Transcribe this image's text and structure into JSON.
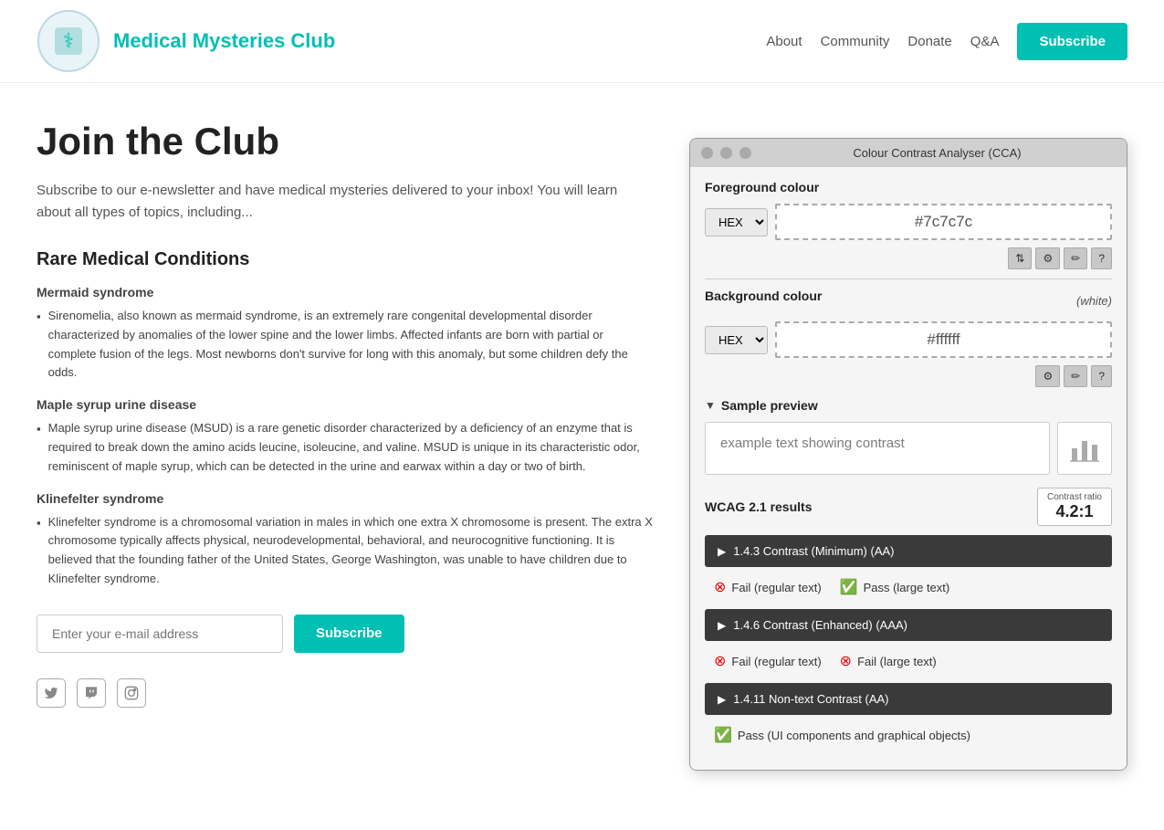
{
  "header": {
    "site_title": "Medical Mysteries Club",
    "nav": {
      "about": "About",
      "community": "Community",
      "donate": "Donate",
      "qa": "Q&A",
      "subscribe": "Subscribe"
    }
  },
  "main": {
    "page_title": "Join the Club",
    "intro": "Subscribe to our e-newsletter and have medical mysteries delivered to your inbox! You will learn about all types of topics, including...",
    "section_title": "Rare Medical Conditions",
    "conditions": [
      {
        "name": "Mermaid syndrome",
        "description": "Sirenomelia, also known as mermaid syndrome, is an extremely rare congenital developmental disorder characterized by anomalies of the lower spine and the lower limbs. Affected infants are born with partial or complete fusion of the legs. Most newborns don't survive for long with this anomaly, but some children defy the odds."
      },
      {
        "name": "Maple syrup urine disease",
        "description": "Maple syrup urine disease (MSUD) is a rare genetic disorder characterized by a deficiency of an enzyme that is required to break down the amino acids leucine, isoleucine, and valine. MSUD is unique in its characteristic odor, reminiscent of maple syrup, which can be detected in the urine and earwax within a day or two of birth."
      },
      {
        "name": "Klinefelter syndrome",
        "description": "Klinefelter syndrome is a chromosomal variation in males in which one extra X chromosome is present. The extra X chromosome typically affects physical, neurodevelopmental, behavioral, and neurocognitive functioning. It is believed that the founding father of the United States, George Washington, was unable to have children due to Klinefelter syndrome."
      }
    ],
    "email_placeholder": "Enter your e-mail address",
    "subscribe_btn": "Subscribe"
  },
  "cca": {
    "title": "Colour Contrast Analyser (CCA)",
    "foreground_label": "Foreground colour",
    "foreground_format": "HEX",
    "foreground_value": "#7c7c7c",
    "background_label": "Background colour",
    "background_white_note": "(white)",
    "background_format": "HEX",
    "background_value": "#ffffff",
    "sample_preview_label": "Sample preview",
    "sample_text": "example text showing contrast",
    "wcag_label": "WCAG 2.1 results",
    "contrast_ratio_label": "Contrast ratio",
    "contrast_ratio_value": "4.2:1",
    "wcag_items": [
      {
        "id": "1.4.3",
        "label": "1.4.3 Contrast (Minimum) (AA)",
        "results": [
          {
            "type": "fail",
            "text": "Fail (regular text)"
          },
          {
            "type": "pass",
            "text": "Pass (large text)"
          }
        ]
      },
      {
        "id": "1.4.6",
        "label": "1.4.6 Contrast (Enhanced) (AAA)",
        "results": [
          {
            "type": "fail",
            "text": "Fail (regular text)"
          },
          {
            "type": "fail",
            "text": "Fail (large text)"
          }
        ]
      },
      {
        "id": "1.4.11",
        "label": "1.4.11 Non-text Contrast (AA)",
        "results": [
          {
            "type": "pass",
            "text": "Pass (UI components and graphical objects)"
          }
        ]
      }
    ]
  },
  "social": {
    "twitter_icon": "🐦",
    "twitch_icon": "📺",
    "instagram_icon": "📷"
  }
}
